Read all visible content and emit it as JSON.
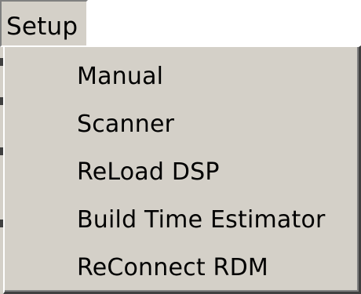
{
  "menubar": {
    "active_menu_label": "Setup"
  },
  "setup_menu": {
    "items": [
      {
        "label": "Manual"
      },
      {
        "label": "Scanner"
      },
      {
        "label": "ReLoad DSP"
      },
      {
        "label": "Build Time Estimator"
      },
      {
        "label": "ReConnect RDM"
      }
    ]
  },
  "colors": {
    "menu_background": "#d4d0c8",
    "text": "#000000",
    "highlight_edge": "#ffffff",
    "shadow_edge": "#404040"
  }
}
